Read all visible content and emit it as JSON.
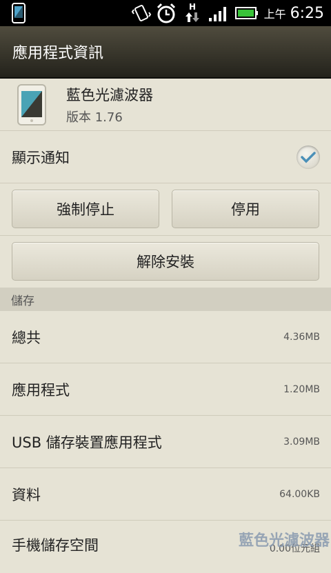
{
  "status_bar": {
    "ampm": "上午",
    "time": "6:25",
    "network_label": "H"
  },
  "title": "應用程式資訊",
  "app": {
    "name": "藍色光濾波器",
    "version": "版本 1.76"
  },
  "notification": {
    "label": "顯示通知",
    "checked": true
  },
  "buttons": {
    "force_stop": "強制停止",
    "disable": "停用",
    "uninstall": "解除安裝"
  },
  "storage": {
    "header": "儲存",
    "rows": [
      {
        "label": "總共",
        "value": "4.36MB"
      },
      {
        "label": "應用程式",
        "value": "1.20MB"
      },
      {
        "label": "USB 儲存裝置應用程式",
        "value": "3.09MB"
      },
      {
        "label": "資料",
        "value": "64.00KB"
      },
      {
        "label": "手機儲存空間",
        "value": "0.00位元組"
      }
    ]
  },
  "watermark": "藍色光濾波器",
  "colors": {
    "background": "#e6e3d5",
    "title_bar": "#3a372c",
    "check_accent": "#4b90b8",
    "battery": "#39c339"
  }
}
